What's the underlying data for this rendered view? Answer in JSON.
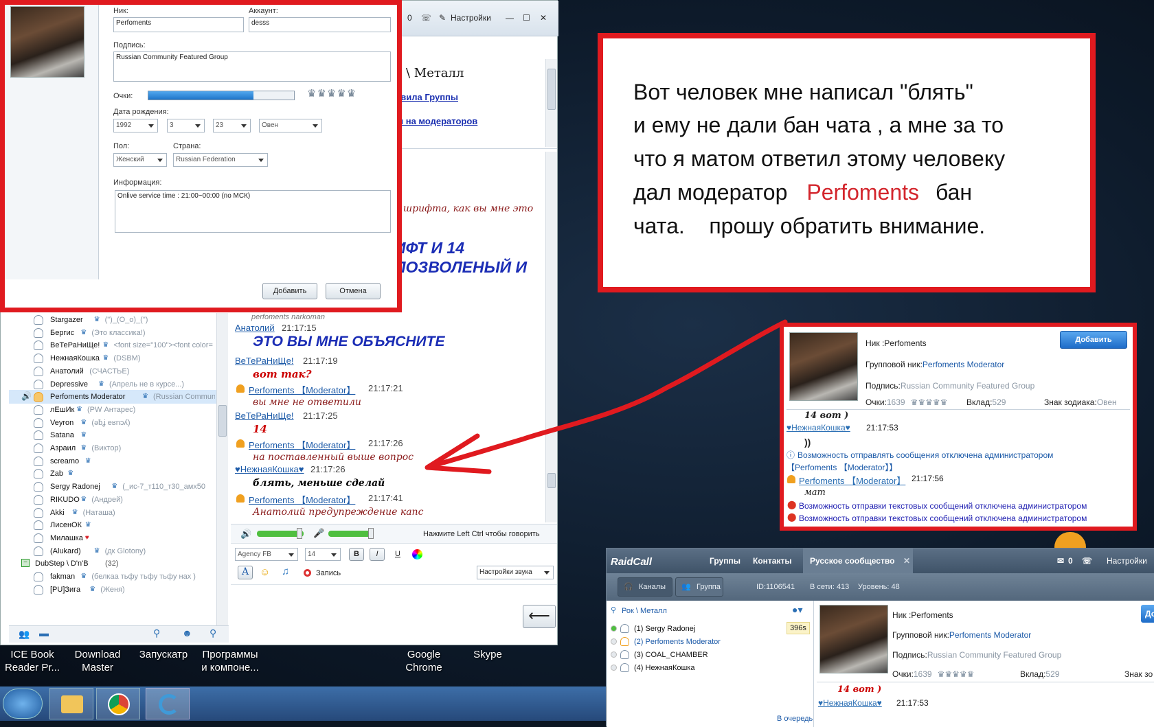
{
  "main_window": {
    "header": {
      "counter": "0",
      "settings": "Настройки"
    },
    "channel_title": "к \\ Металл",
    "links": [
      "авила Группы",
      "ы на модераторов"
    ],
    "partial_lines": [
      {
        "text": "о шрифта, как вы мне это",
        "style": "brit"
      },
      {
        "text": "ИФТ И 14",
        "style": "bigblue"
      },
      {
        "text": "ПОЗВОЛЕНЫЙ И",
        "style": "bigblue"
      }
    ],
    "messages": [
      {
        "text": "perfoments narkoman",
        "style": "gray"
      },
      {
        "user": "Анатолий",
        "time": "21:17:15"
      },
      {
        "text": "ЭТО ВЫ МНЕ ОБЪЯСНИТЕ",
        "style": "bigblue"
      },
      {
        "user": "ВеТеРаНиЩе!",
        "time": "21:17:19"
      },
      {
        "text": "вот так?",
        "style": "redit"
      },
      {
        "user": "Perfoments 【Moderator】",
        "time": "21:17:21"
      },
      {
        "text": "вы мне не ответили",
        "style": "brit"
      },
      {
        "user": "ВеТеРаНиЩе!",
        "time": "21:17:25"
      },
      {
        "text": "14",
        "style": "redit"
      },
      {
        "user": "Perfoments 【Moderator】",
        "time": "21:17:26"
      },
      {
        "text": "на поставленный выше вопрос",
        "style": "brit"
      },
      {
        "user": "♥НежнаяКошка♥",
        "time": "21:17:26"
      },
      {
        "text": "блять, меньше сделай",
        "style": "blackit"
      },
      {
        "user": "Perfoments 【Moderator】",
        "time": "21:17:41"
      },
      {
        "text": "Анатолий предупреждение капс",
        "style": "brit"
      }
    ],
    "voice": {
      "hint": "Нажмите Left Ctrl чтобы говорить"
    },
    "format": {
      "font": "Agency FB",
      "size": "14",
      "bold": "B",
      "italic": "I",
      "underline": "U"
    },
    "record": "Запись",
    "sound_settings": "Настройки звука",
    "send_symbol": "⟵",
    "users": [
      {
        "name": "Stargazer",
        "rank": "♛",
        "status": "(\")_(O_o)_(\")"
      },
      {
        "name": "Бергис",
        "rank": "♛",
        "status": "(Это классика!)"
      },
      {
        "name": "ВеТеРаНиЩе!",
        "rank": "♛",
        "status": "<font size=\"100\"><font color="
      },
      {
        "name": "НежнаяКошка",
        "rank": "♛",
        "status": "(DSBM)"
      },
      {
        "name": "Анатолий",
        "rank": "",
        "status": "(СЧАСТЬЕ)"
      },
      {
        "name": "Depressive",
        "rank": "♛",
        "status": "(Апрель не в курсе...)"
      },
      {
        "name": "Perfoments Moderator",
        "rank": "♛",
        "status": "(Russian Community F",
        "selected": true
      },
      {
        "name": "лЕшИк",
        "rank": "♛",
        "status": "(PW Антарес)"
      },
      {
        "name": "Veyron",
        "rank": "♛",
        "status": "(əƀʝ eʁnɔʎ)"
      },
      {
        "name": "Satana",
        "rank": "♛",
        "status": ""
      },
      {
        "name": "Азраил",
        "rank": "♛",
        "status": "(Виктор)"
      },
      {
        "name": "screamo",
        "rank": "♛",
        "status": ""
      },
      {
        "name": "Zab",
        "rank": "♛",
        "status": ""
      },
      {
        "name": "Sergy Radonej",
        "rank": "♛",
        "status": "(_ис-7_т110_т30_амх50"
      },
      {
        "name": "RIKUDO",
        "rank": "♛",
        "status": "(Андрей)"
      },
      {
        "name": "Akki",
        "rank": "♛",
        "status": "(Наташа)"
      },
      {
        "name": "ЛисенОК",
        "rank": "♛",
        "status": ""
      },
      {
        "name": "Милашка",
        "rank": "♥",
        "status": ""
      },
      {
        "name": "(Alukard)",
        "rank": "♛",
        "status": "(дк Glotony)"
      },
      {
        "name": "DubStep \\ D'n'B",
        "rank": "",
        "status": "(32)",
        "group": true
      },
      {
        "name": "fakman",
        "rank": "♛",
        "status": "(белкаа тьфу тьфу тьфу нах )"
      },
      {
        "name": "[PU]Зига",
        "rank": "♛",
        "status": "(Женя)"
      }
    ]
  },
  "profile_dialog": {
    "nick_label": "Ник:",
    "nick": "Perfoments",
    "account_label": "Аккаунт:",
    "account": "desss",
    "signature_label": "Подпись:",
    "signature": "Russian Community Featured Group",
    "points_label": "Очки:",
    "points_fill": 0.72,
    "birth_label": "Дата рождения:",
    "year": "1992",
    "month": "3",
    "day": "23",
    "zodiac": "Овен",
    "gender_label": "Пол:",
    "gender": "Женский",
    "country_label": "Страна:",
    "country": "Russian Federation",
    "info_label": "Информация:",
    "info": "Onlive service time : 21:00~00:00 (по МСК)",
    "add_button": "Добавить",
    "cancel_button": "Отмена"
  },
  "annotation": {
    "line1": "Вот человек мне написал \"блять\"",
    "line2": "и ему не дали бан чата , а мне за то",
    "line3": "что я матом ответил этому человеку",
    "line4a": "дал модератор",
    "line4_name": "Perfoments",
    "line4b": "бан",
    "line5": "чата.    прошу обратить внимание."
  },
  "popup": {
    "nick": "Ник :Perfoments",
    "add_button": "Добавить",
    "group_nick_label": "Групповой ник:",
    "group_nick": "Perfoments Moderator",
    "signature_label": "Подпись:",
    "signature": "Russian Community Featured Group",
    "points_label": "Очки:",
    "points": "1639",
    "contrib_label": "Вклад:",
    "contrib": "529",
    "zodiac_label": "Знак зодиака:",
    "zodiac": "Овен",
    "msg1": "14 вот )",
    "user1": "♥НежнаяКошка♥",
    "time1": "21:17:53",
    "msg2": "))",
    "sys1": "Возможность отправлять сообщения отключена администратором",
    "sys1b": "【Perfoments 【Moderator】】",
    "user2": "Perfoments 【Moderator】",
    "time2": "21:17:56",
    "msg3": "мат",
    "sys2": "Возможность отправки текстовых сообщений отключена администратором",
    "sys3": "Возможность отправки текстовых сообщений отключена администратором"
  },
  "raidcall": {
    "logo": "RaidCall",
    "tabs": [
      "Группы",
      "Контакты",
      "Русское сообщество"
    ],
    "mail_count": "0",
    "settings": "Настройки",
    "channels_btn": "Каналы",
    "group_btn": "Группа",
    "id": "ID:1106541",
    "online": "В сети: 413",
    "level": "Уровень: 48",
    "channel": "Рок \\ Металл",
    "queue": "В очередь",
    "badge": "396s",
    "members": [
      "(1) Sergy Radonej",
      "(2) Perfoments Moderator",
      "(3) COAL_CHAMBER",
      "(4) НежнаяКошка"
    ],
    "profile_nick": "Ник :Perfoments",
    "add_short": "До",
    "group_nick_label": "Групповой ник:",
    "group_nick": "Perfoments Moderator",
    "signature_label": "Подпись:",
    "signature": "Russian Community Featured Group",
    "points_label": "Очки:",
    "points": "1639",
    "contrib_label": "Вклад:",
    "contrib": "529",
    "zodiac_cut": "Знак зо",
    "msg": "14 вот )",
    "msg_user": "♥НежнаяКошка♥",
    "msg_time": "21:17:53"
  },
  "desktop": {
    "icons": [
      {
        "label1": "ICE Book",
        "label2": "Reader Pr..."
      },
      {
        "label1": "Download",
        "label2": "Master"
      },
      {
        "label1": "Запускатр",
        "label2": ""
      },
      {
        "label1": "Программы",
        "label2": "и компоне..."
      },
      {
        "label1": "Google",
        "label2": "Chrome"
      },
      {
        "label1": "Skype",
        "label2": ""
      }
    ]
  }
}
